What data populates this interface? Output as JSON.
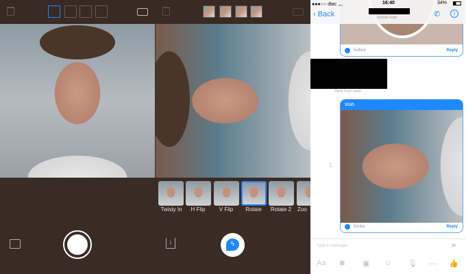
{
  "camera": {
    "icons": [
      "trash-icon",
      "camera-flip-icon",
      "gallery-icon",
      "shutter-icon"
    ]
  },
  "editor": {
    "filters": [
      {
        "label": "Twisty In"
      },
      {
        "label": "H Flip"
      },
      {
        "label": "V Flip"
      },
      {
        "label": "Rotate",
        "selected": true
      },
      {
        "label": "Rotate 2"
      },
      {
        "label": "Zoo"
      }
    ]
  },
  "messenger": {
    "status": {
      "carrier": "dtac",
      "time": "16:40",
      "battery": "34%"
    },
    "nav": {
      "back": "Back",
      "subtitle": "Active now"
    },
    "messages": [
      {
        "app": "Selfied",
        "reply": "Reply"
      },
      {
        "caption": "Sent from web"
      },
      {
        "header": "Wah",
        "app": "Strobe",
        "reply": "Reply"
      }
    ],
    "input_placeholder": "Type a message...",
    "toolbar": {
      "text": "Aa"
    },
    "accent": "#1e88ff"
  }
}
